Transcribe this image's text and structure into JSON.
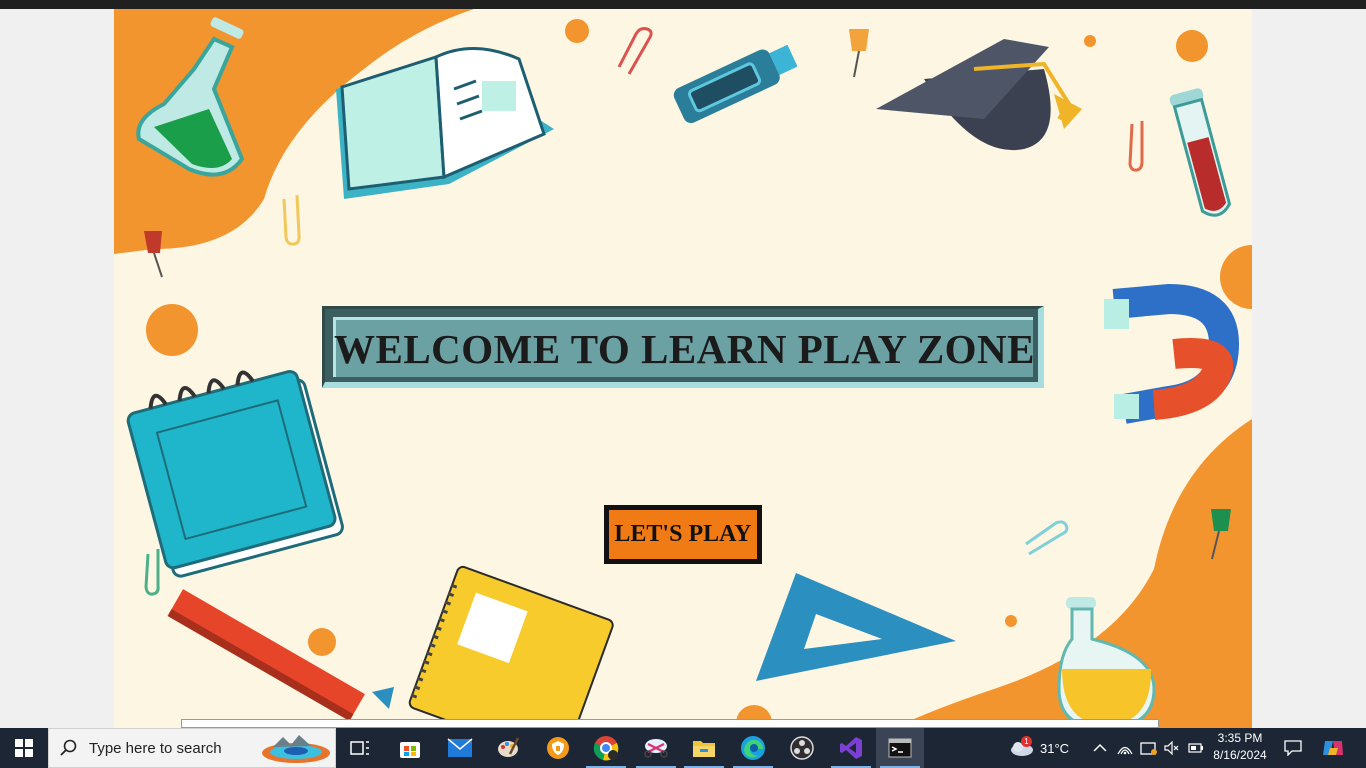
{
  "app": {
    "title": "WELCOME TO LEARN PLAY ZONE",
    "play_button": "LET'S PLAY"
  },
  "taskbar": {
    "search_placeholder": "Type here to search",
    "apps": [
      {
        "name": "task-view-icon"
      },
      {
        "name": "microsoft-store-icon"
      },
      {
        "name": "mail-icon"
      },
      {
        "name": "paint-icon"
      },
      {
        "name": "vpn-shield-icon"
      },
      {
        "name": "chrome-icon"
      },
      {
        "name": "snipping-tool-icon"
      },
      {
        "name": "file-explorer-icon"
      },
      {
        "name": "edge-icon"
      },
      {
        "name": "obs-icon"
      },
      {
        "name": "visual-studio-icon"
      },
      {
        "name": "terminal-icon"
      }
    ],
    "weather": {
      "temp": "31°C",
      "badge": "1"
    },
    "clock": {
      "time": "3:35 PM",
      "date": "8/16/2024"
    }
  },
  "colors": {
    "accent_orange": "#f07a13",
    "frame_teal": "#6ba1a3",
    "background": "#fdf6e3",
    "taskbar": "#1c2635"
  }
}
